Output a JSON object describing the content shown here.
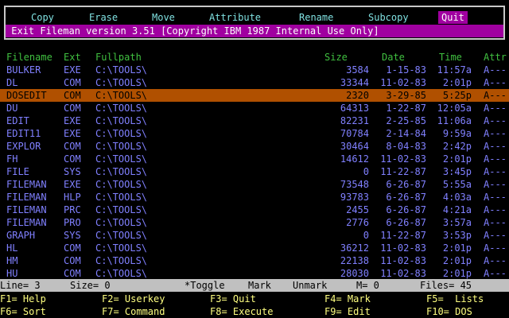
{
  "menu": {
    "items": [
      "Copy",
      "Erase",
      "Move",
      "Attribute",
      "Rename",
      "Subcopy"
    ],
    "quit_label": "Quit"
  },
  "status_message": " Exit Fileman version 3.51 [Copyright IBM 1987 Internal Use Only]",
  "columns": {
    "filename": "Filename",
    "ext": "Ext",
    "fullpath": "Fullpath",
    "size": "Size",
    "date": "Date",
    "time": "Time",
    "attr": "Attr"
  },
  "files": [
    {
      "name": "BULKER",
      "ext": "EXE",
      "path": "C:\\TOOLS\\",
      "size": "3584",
      "date": "1-15-83",
      "time": "11:57a",
      "attr": "A---"
    },
    {
      "name": "DL",
      "ext": "COM",
      "path": "C:\\TOOLS\\",
      "size": "33344",
      "date": "11-02-83",
      "time": "2:01p",
      "attr": "A---"
    },
    {
      "name": "DOSEDIT",
      "ext": "COM",
      "path": "C:\\TOOLS\\",
      "size": "2320",
      "date": "3-29-85",
      "time": "5:25p",
      "attr": "A---",
      "selected": true
    },
    {
      "name": "DU",
      "ext": "COM",
      "path": "C:\\TOOLS\\",
      "size": "64313",
      "date": "1-22-87",
      "time": "12:05a",
      "attr": "A---"
    },
    {
      "name": "EDIT",
      "ext": "EXE",
      "path": "C:\\TOOLS\\",
      "size": "82231",
      "date": "2-25-85",
      "time": "11:06a",
      "attr": "A---"
    },
    {
      "name": "EDIT11",
      "ext": "EXE",
      "path": "C:\\TOOLS\\",
      "size": "70784",
      "date": "2-14-84",
      "time": "9:59a",
      "attr": "A---"
    },
    {
      "name": "EXPLOR",
      "ext": "COM",
      "path": "C:\\TOOLS\\",
      "size": "30464",
      "date": "8-04-83",
      "time": "2:42p",
      "attr": "A---"
    },
    {
      "name": "FH",
      "ext": "COM",
      "path": "C:\\TOOLS\\",
      "size": "14612",
      "date": "11-02-83",
      "time": "2:01p",
      "attr": "A---"
    },
    {
      "name": "FILE",
      "ext": "SYS",
      "path": "C:\\TOOLS\\",
      "size": "0",
      "date": "11-22-87",
      "time": "3:45p",
      "attr": "A---"
    },
    {
      "name": "FILEMAN",
      "ext": "EXE",
      "path": "C:\\TOOLS\\",
      "size": "73548",
      "date": "6-26-87",
      "time": "5:55a",
      "attr": "A---"
    },
    {
      "name": "FILEMAN",
      "ext": "HLP",
      "path": "C:\\TOOLS\\",
      "size": "93783",
      "date": "6-26-87",
      "time": "4:03a",
      "attr": "A---"
    },
    {
      "name": "FILEMAN",
      "ext": "PRC",
      "path": "C:\\TOOLS\\",
      "size": "2455",
      "date": "6-26-87",
      "time": "4:21a",
      "attr": "A---"
    },
    {
      "name": "FILEMAN",
      "ext": "PRO",
      "path": "C:\\TOOLS\\",
      "size": "2776",
      "date": "6-26-87",
      "time": "3:57a",
      "attr": "A---"
    },
    {
      "name": "GRAPH",
      "ext": "SYS",
      "path": "C:\\TOOLS\\",
      "size": "0",
      "date": "11-22-87",
      "time": "3:53p",
      "attr": "A---"
    },
    {
      "name": "HL",
      "ext": "COM",
      "path": "C:\\TOOLS\\",
      "size": "36212",
      "date": "11-02-83",
      "time": "2:01p",
      "attr": "A---"
    },
    {
      "name": "HM",
      "ext": "COM",
      "path": "C:\\TOOLS\\",
      "size": "22138",
      "date": "11-02-83",
      "time": "2:01p",
      "attr": "A---"
    },
    {
      "name": "HU",
      "ext": "COM",
      "path": "C:\\TOOLS\\",
      "size": "28030",
      "date": "11-02-83",
      "time": "2:01p",
      "attr": "A---"
    }
  ],
  "bottom": {
    "line": "Line= 3",
    "size": "Size= 0",
    "toggle": "*Toggle",
    "mark": "Mark",
    "unmark": "Unmark",
    "m": "M= 0",
    "files": "Files= 45"
  },
  "fkeys": {
    "f1": "F1= Help",
    "f2": "F2= Userkey",
    "f3": "F3= Quit",
    "f4": "F4= Mark",
    "f5": "F5=  Lists",
    "f6": "F6= Sort",
    "f7": "F7= Command",
    "f8": "F8= Execute",
    "f9": "F9= Edit",
    "f10": "F10= DOS"
  }
}
